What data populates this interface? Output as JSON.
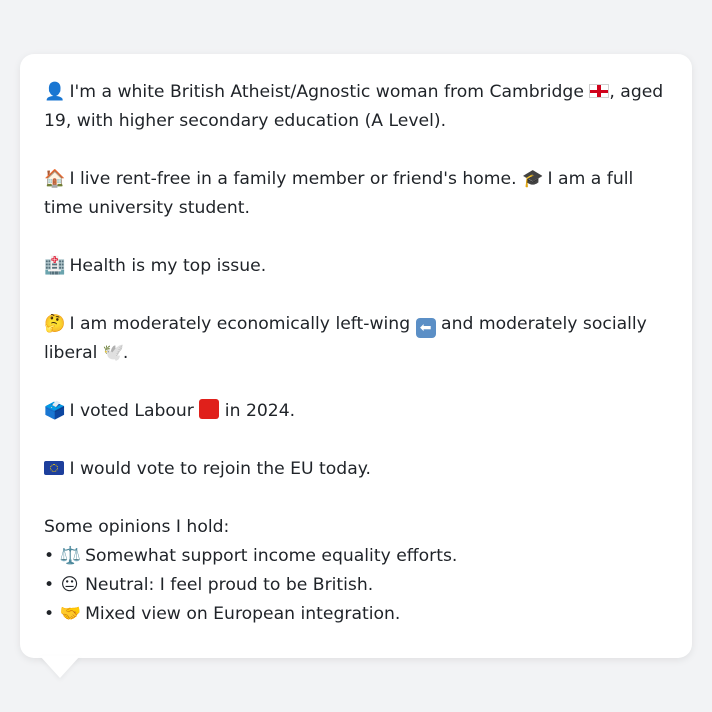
{
  "profile": {
    "intro": {
      "icon": "bust-in-silhouette-icon",
      "text_before_flag": "I'm a white British Atheist/Agnostic woman from Cambridge ",
      "flag": "england-flag-icon",
      "text_after_flag": ", aged 19, with higher secondary education (A Level)."
    },
    "housing": {
      "icon": "house-icon",
      "text": "I live rent-free in a family member or friend's home. ",
      "icon2": "graduation-cap-icon",
      "text2": "I am a full time university student."
    },
    "issue": {
      "icon": "hospital-icon",
      "text": "Health is my top issue."
    },
    "politics": {
      "icon": "thinking-face-icon",
      "text_before": "I am moderately economically left-wing ",
      "arrow_icon": "left-arrow-icon",
      "text_middle": " and moderately socially liberal ",
      "dove_icon": "dove-icon",
      "text_after": "."
    },
    "vote": {
      "icon": "ballot-box-icon",
      "text_before": "I voted Labour ",
      "square_icon": "red-square-icon",
      "text_after": " in 2024."
    },
    "eu": {
      "icon": "eu-flag-icon",
      "text": "I would vote to rejoin the EU today."
    },
    "opinions": {
      "heading": "Some opinions I hold:",
      "items": [
        {
          "icon": "balance-scale-icon",
          "glyph": "⚖️",
          "text": "Somewhat support income equality efforts."
        },
        {
          "icon": "neutral-face-icon",
          "glyph": "😐",
          "text": "Neutral: I feel proud to be British."
        },
        {
          "icon": "handshake-icon",
          "glyph": "🤝",
          "text": "Mixed view on European integration."
        }
      ]
    }
  },
  "colors": {
    "background": "#f2f3f5",
    "bubble": "#ffffff",
    "text": "#1f2328"
  }
}
